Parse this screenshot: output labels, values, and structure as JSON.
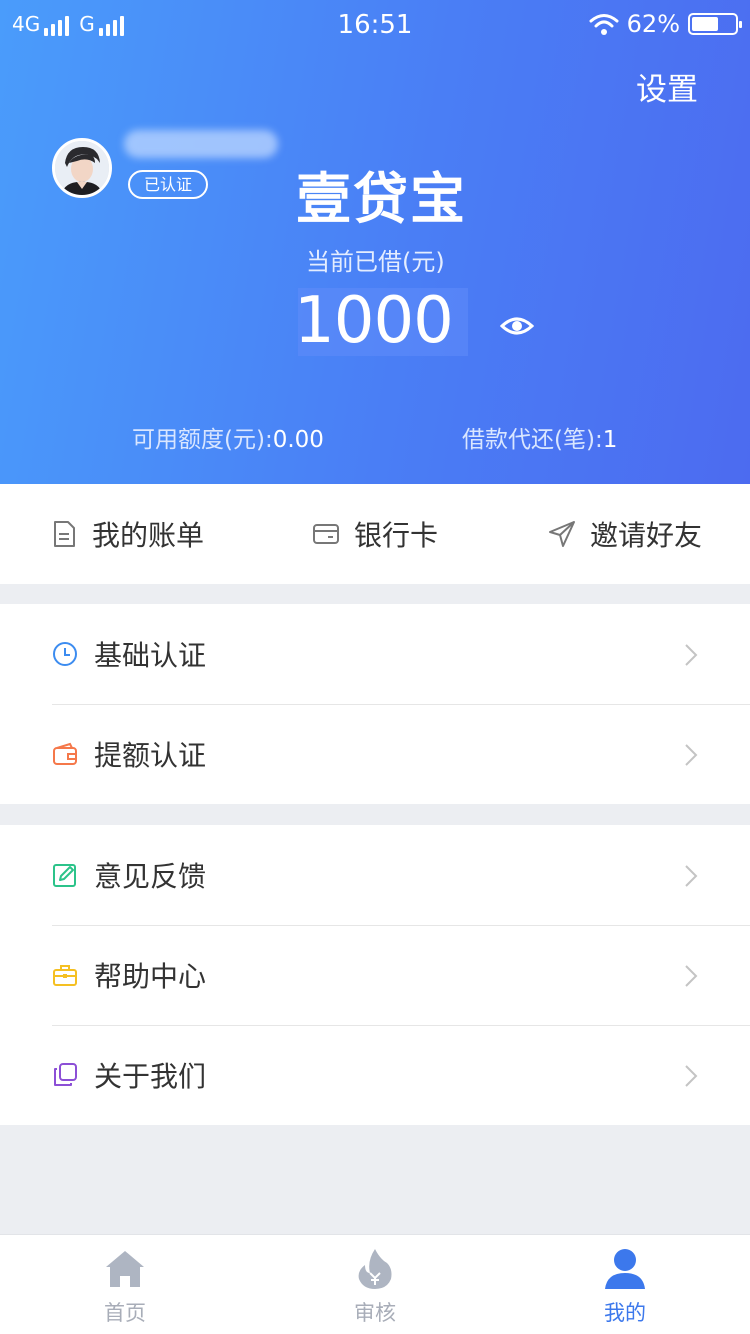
{
  "status_bar": {
    "network_left": "4G",
    "network_mid": "G",
    "time": "16:51",
    "battery": "62%",
    "battery_level": 0.62
  },
  "header": {
    "settings_label": "设置",
    "verified_badge": "已认证",
    "app_title": "壹贷宝",
    "borrowed_label": "当前已借(元)",
    "borrowed_amount": "1000",
    "available_label": "可用额度(元):",
    "available_value": "0.00",
    "repay_label": "借款代还(笔):",
    "repay_value": "1"
  },
  "quick_links": [
    {
      "label": "我的账单",
      "icon": "bill-document-icon"
    },
    {
      "label": "银行卡",
      "icon": "bank-card-icon"
    },
    {
      "label": "邀请好友",
      "icon": "paper-plane-icon"
    }
  ],
  "menu": {
    "group1": [
      {
        "label": "基础认证",
        "icon": "clock-icon",
        "color": "#3c8cf0"
      },
      {
        "label": "提额认证",
        "icon": "wallet-icon",
        "color": "#f5784a"
      }
    ],
    "group2": [
      {
        "label": "意见反馈",
        "icon": "edit-icon",
        "color": "#2cc38a"
      },
      {
        "label": "帮助中心",
        "icon": "briefcase-icon",
        "color": "#f5c022"
      },
      {
        "label": "关于我们",
        "icon": "copy-icon",
        "color": "#8c4fd6"
      }
    ]
  },
  "tabbar": [
    {
      "label": "首页",
      "icon": "home-icon",
      "active": false
    },
    {
      "label": "审核",
      "icon": "flame-yuan-icon",
      "active": false
    },
    {
      "label": "我的",
      "icon": "user-icon",
      "active": true
    }
  ],
  "colors": {
    "header_gradient_start": "#4a9cfb",
    "header_gradient_end": "#4c6bf0",
    "accent": "#3c78ec",
    "tab_inactive": "#a8adb8"
  }
}
